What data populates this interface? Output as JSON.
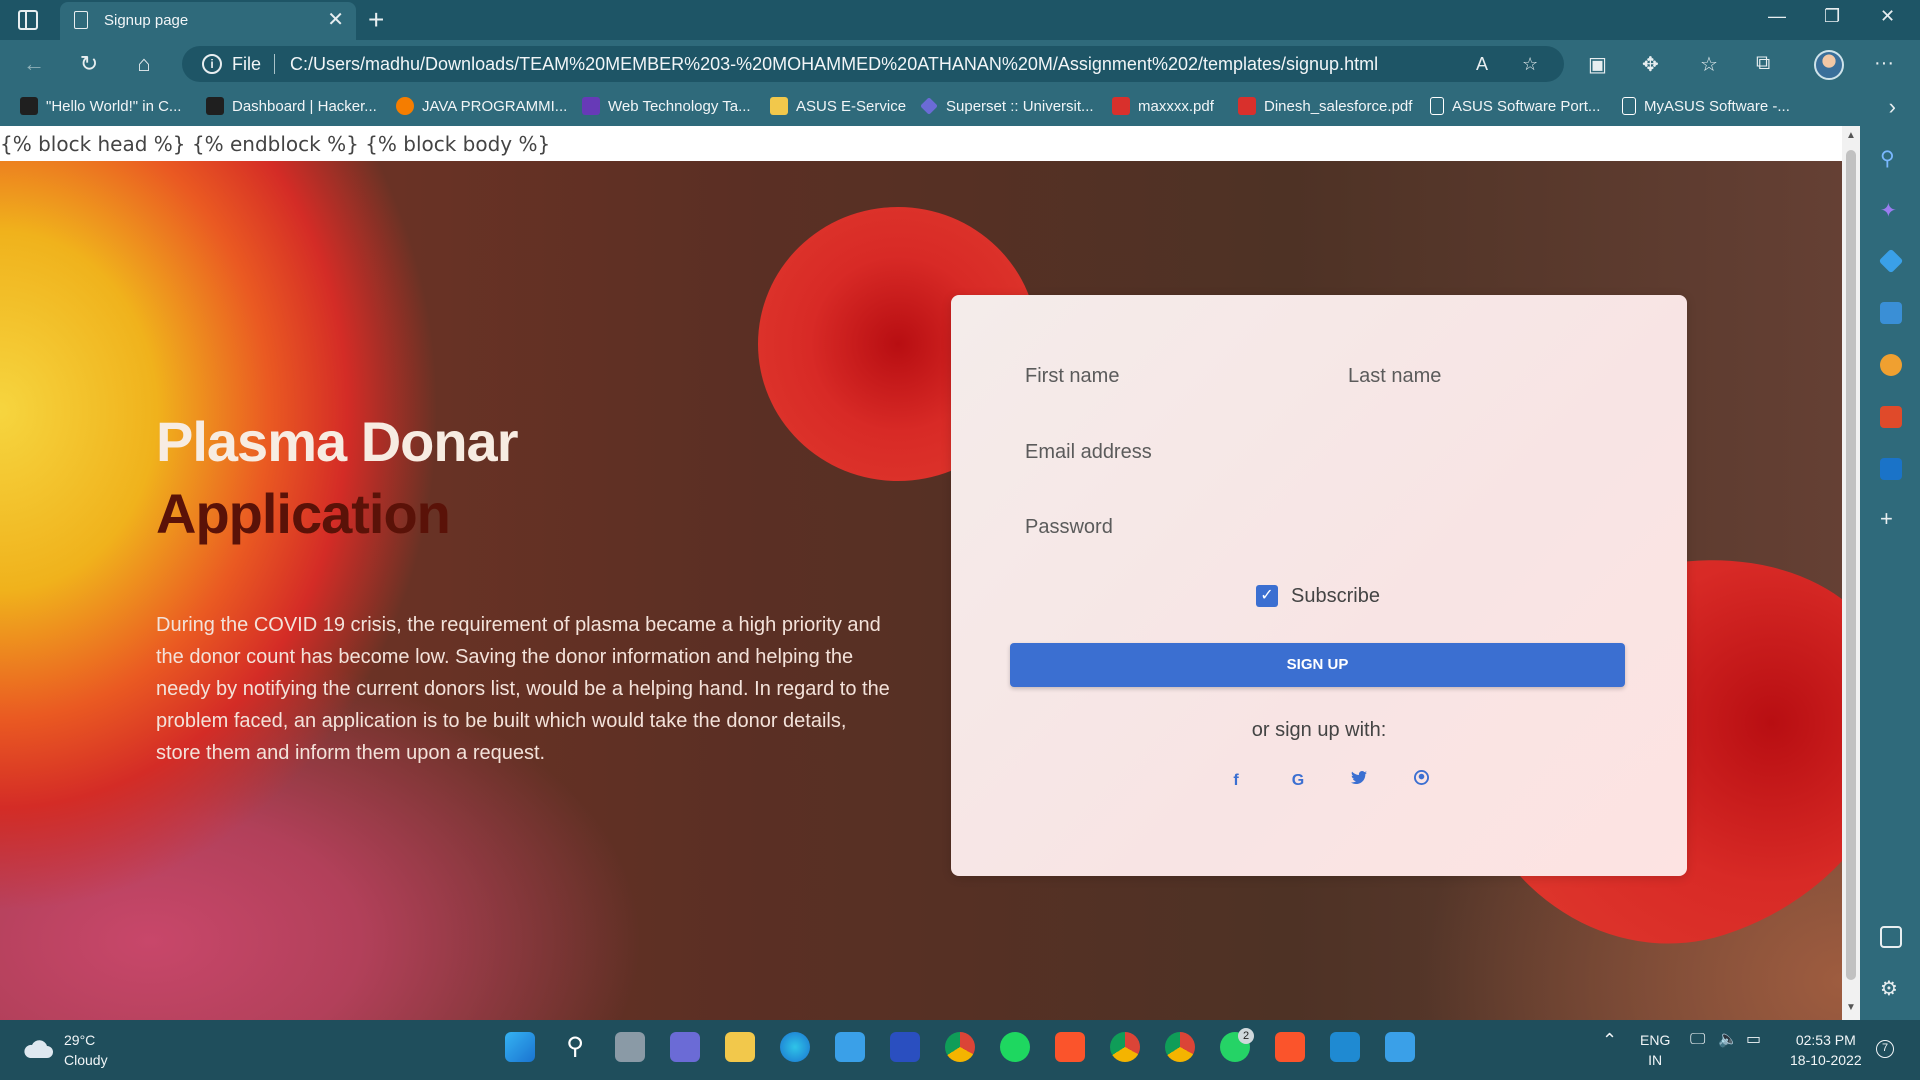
{
  "browser": {
    "tab_title": "Signup page",
    "address_prefix": "File",
    "url": "C:/Users/madhu/Downloads/TEAM%20MEMBER%203-%20MOHAMMED%20ATHANAN%20M/Assignment%202/templates/signup.html"
  },
  "bookmarks": [
    {
      "label": "\"Hello World!\" in C...",
      "icon": "hackerrank-icon",
      "color": "#1f1f1f"
    },
    {
      "label": "Dashboard | Hacker...",
      "icon": "hackerrank-icon",
      "color": "#1f1f1f"
    },
    {
      "label": "JAVA PROGRAMMI...",
      "icon": "blogger-icon",
      "color": "#f57d00"
    },
    {
      "label": "Web Technology Ta...",
      "icon": "forms-icon",
      "color": "#673ab7"
    },
    {
      "label": "ASUS E-Service",
      "icon": "folder-icon",
      "color": "#f2c84b"
    },
    {
      "label": "Superset :: Universit...",
      "icon": "superset-icon",
      "color": "#6b6bd6"
    },
    {
      "label": "maxxxx.pdf",
      "icon": "pdf-icon",
      "color": "#d9302c"
    },
    {
      "label": "Dinesh_salesforce.pdf",
      "icon": "pdf-icon",
      "color": "#d9302c"
    },
    {
      "label": "ASUS Software Port...",
      "icon": "page-icon",
      "color": "#ffffff"
    },
    {
      "label": "MyASUS Software -...",
      "icon": "page-icon",
      "color": "#ffffff"
    }
  ],
  "page": {
    "template_text": "{% block head %} {% endblock %} {% block body %}",
    "heading_line1": "Plasma Donar",
    "heading_line2": "Application",
    "description": "During the COVID 19 crisis, the requirement of plasma became a high priority and the donor count has become low. Saving the donor information and helping the needy by notifying the current donors list, would be a helping hand. In regard to the problem faced, an application is to be built which would take the donor details, store them and inform them upon a request.",
    "form": {
      "first_name_placeholder": "First name",
      "last_name_placeholder": "Last name",
      "email_placeholder": "Email address",
      "password_placeholder": "Password",
      "subscribe_label": "Subscribe",
      "subscribe_checked": true,
      "signup_label": "SIGN UP",
      "or_text": "or sign up with:",
      "social": [
        "facebook-icon",
        "google-icon",
        "twitter-icon",
        "github-icon"
      ]
    }
  },
  "taskbar": {
    "temperature": "29°C",
    "weather": "Cloudy",
    "lang1": "ENG",
    "lang2": "IN",
    "time": "02:53 PM",
    "date": "18-10-2022",
    "notifications": "7",
    "whatsapp_badge": "2"
  },
  "colors": {
    "accent": "#3b6fd1",
    "browser_chrome": "#2f6a7b"
  }
}
